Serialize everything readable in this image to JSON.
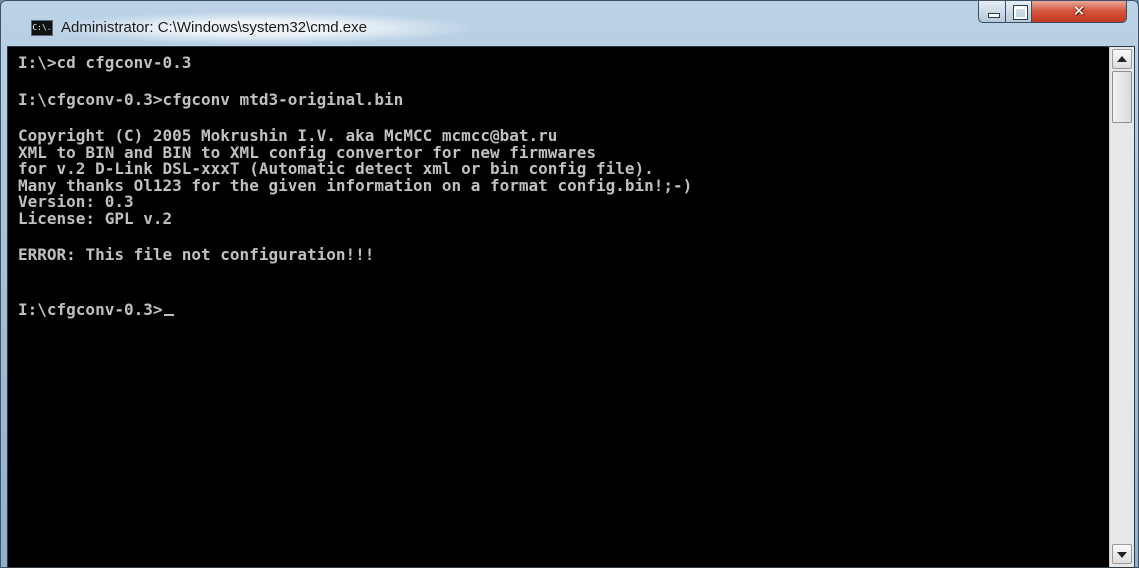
{
  "window": {
    "title": "Administrator: C:\\Windows\\system32\\cmd.exe",
    "icon_label": "C:\\."
  },
  "console": {
    "lines": [
      "I:\\>cd cfgconv-0.3",
      "I:\\cfgconv-0.3>cfgconv mtd3-original.bin",
      "Copyright (C) 2005 Mokrushin I.V. aka McMCC mcmcc@bat.ru",
      "XML to BIN and BIN to XML config convertor for new firmwares",
      "for v.2 D-Link DSL-xxxT (Automatic detect xml or bin config file).",
      "Many thanks Ol123 for the given information on a format config.bin!;-)",
      "Version: 0.3",
      "License: GPL v.2",
      "ERROR: This file not configuration!!!",
      "I:\\cfgconv-0.3>"
    ]
  },
  "colors": {
    "console_bg": "#000000",
    "console_fg": "#c0c0c0",
    "close_button": "#c8452d"
  },
  "icons": {
    "app": "cmd-app-icon",
    "minimize": "minimize-icon",
    "maximize": "maximize-icon",
    "close": "close-icon",
    "scroll_up": "scroll-up-arrow-icon",
    "scroll_down": "scroll-down-arrow-icon"
  }
}
